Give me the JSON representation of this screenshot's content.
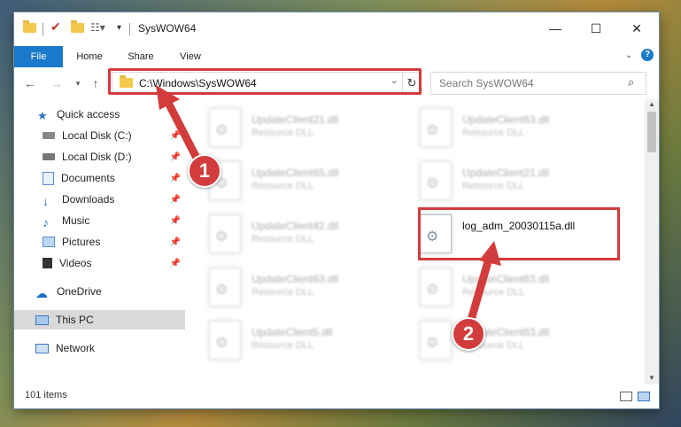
{
  "window": {
    "title": "SysWOW64"
  },
  "controls": {
    "minimize": "—",
    "maximize": "☐",
    "close": "✕"
  },
  "ribbon": {
    "tabs": [
      "File",
      "Home",
      "Share",
      "View"
    ]
  },
  "address": {
    "path": "C:\\Windows\\SysWOW64"
  },
  "search": {
    "placeholder": "Search SysWOW64"
  },
  "nav": {
    "items": [
      {
        "label": "Quick access",
        "icon": "star-icon"
      },
      {
        "label": "Local Disk (C:)",
        "icon": "drive-icon"
      },
      {
        "label": "Local Disk (D:)",
        "icon": "drive-icon"
      },
      {
        "label": "Documents",
        "icon": "documents-icon"
      },
      {
        "label": "Downloads",
        "icon": "download-arrow-icon"
      },
      {
        "label": "Music",
        "icon": "music-note-icon"
      },
      {
        "label": "Pictures",
        "icon": "pictures-icon"
      },
      {
        "label": "Videos",
        "icon": "film-icon"
      },
      {
        "label": "OneDrive",
        "icon": "cloud-icon"
      },
      {
        "label": "This PC",
        "icon": "monitor-icon"
      },
      {
        "label": "Network",
        "icon": "network-icon"
      }
    ]
  },
  "files": [
    {
      "name": "UpdateClient21.dll",
      "type": "Resource DLL"
    },
    {
      "name": "UpdateClient63.dll",
      "type": "Resource DLL"
    },
    {
      "name": "UpdateClient65.dll",
      "type": "Resource DLL"
    },
    {
      "name": "UpdateClient21.dll",
      "type": "Resource DLL"
    },
    {
      "name": "UpdateClient42.dll",
      "type": "Resource DLL"
    },
    {
      "name": "log_adm_20030115a.dll",
      "type": ""
    },
    {
      "name": "UpdateClient63.dll",
      "type": "Resource DLL"
    },
    {
      "name": "UpdateClient63.dll",
      "type": "Resource DLL"
    },
    {
      "name": "UpdateClient5.dll",
      "type": "Resource DLL"
    },
    {
      "name": "UpdateClient63.dll",
      "type": "Resource DLL"
    }
  ],
  "status": {
    "item_count": "101 items"
  },
  "callouts": {
    "step1": "1",
    "step2": "2"
  },
  "colors": {
    "highlight": "#d23c3c",
    "file_tab": "#1979ca"
  }
}
